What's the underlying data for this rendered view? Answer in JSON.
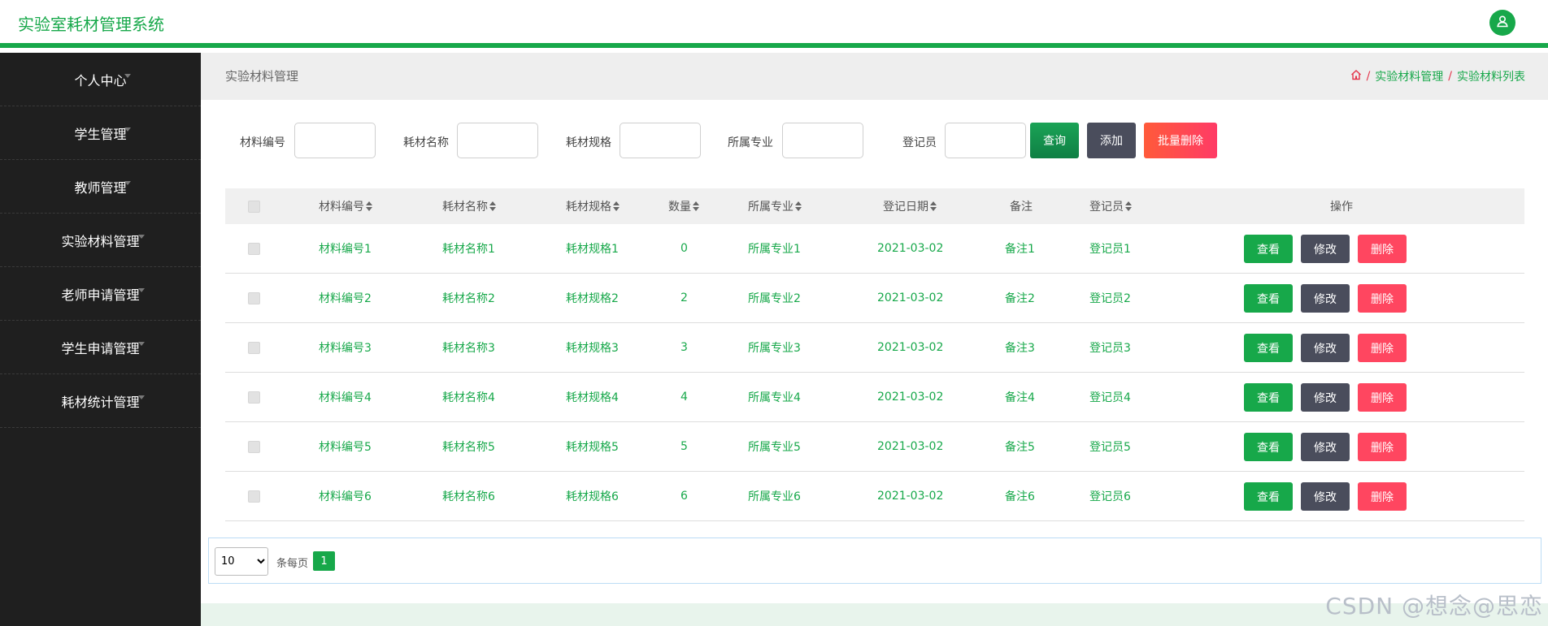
{
  "header": {
    "app_title": "实验室耗材管理系统",
    "avatar_icon": "user-icon",
    "accent_color": "#17a84a"
  },
  "sidebar": {
    "items": [
      {
        "label": "个人中心"
      },
      {
        "label": "学生管理"
      },
      {
        "label": "教师管理"
      },
      {
        "label": "实验材料管理"
      },
      {
        "label": "老师申请管理"
      },
      {
        "label": "学生申请管理"
      },
      {
        "label": "耗材统计管理"
      }
    ]
  },
  "breadcrumb": {
    "page_title": "实验材料管理",
    "home_icon": "home-icon",
    "sep": "/",
    "level1": "实验材料管理",
    "level2": "实验材料列表"
  },
  "search": {
    "fields": [
      {
        "label": "材料编号",
        "value": ""
      },
      {
        "label": "耗材名称",
        "value": ""
      },
      {
        "label": "耗材规格",
        "value": ""
      },
      {
        "label": "所属专业",
        "value": ""
      },
      {
        "label": "登记员",
        "value": ""
      }
    ],
    "query_button": "查询",
    "add_button": "添加",
    "batch_delete_button": "批量删除"
  },
  "table": {
    "columns": [
      "材料编号",
      "耗材名称",
      "耗材规格",
      "数量",
      "所属专业",
      "登记日期",
      "备注",
      "登记员",
      "操作"
    ],
    "rows": [
      {
        "code": "材料编号1",
        "name": "耗材名称1",
        "spec": "耗材规格1",
        "qty": "0",
        "major": "所属专业1",
        "date": "2021-03-02",
        "note": "备注1",
        "registrar": "登记员1"
      },
      {
        "code": "材料编号2",
        "name": "耗材名称2",
        "spec": "耗材规格2",
        "qty": "2",
        "major": "所属专业2",
        "date": "2021-03-02",
        "note": "备注2",
        "registrar": "登记员2"
      },
      {
        "code": "材料编号3",
        "name": "耗材名称3",
        "spec": "耗材规格3",
        "qty": "3",
        "major": "所属专业3",
        "date": "2021-03-02",
        "note": "备注3",
        "registrar": "登记员3"
      },
      {
        "code": "材料编号4",
        "name": "耗材名称4",
        "spec": "耗材规格4",
        "qty": "4",
        "major": "所属专业4",
        "date": "2021-03-02",
        "note": "备注4",
        "registrar": "登记员4"
      },
      {
        "code": "材料编号5",
        "name": "耗材名称5",
        "spec": "耗材规格5",
        "qty": "5",
        "major": "所属专业5",
        "date": "2021-03-02",
        "note": "备注5",
        "registrar": "登记员5"
      },
      {
        "code": "材料编号6",
        "name": "耗材名称6",
        "spec": "耗材规格6",
        "qty": "6",
        "major": "所属专业6",
        "date": "2021-03-02",
        "note": "备注6",
        "registrar": "登记员6"
      }
    ],
    "view_button": "查看",
    "edit_button": "修改",
    "delete_button": "删除"
  },
  "pagination": {
    "page_size": "10",
    "per_page_label": "条每页",
    "current_page": "1"
  },
  "watermark": "CSDN @想念@思恋"
}
